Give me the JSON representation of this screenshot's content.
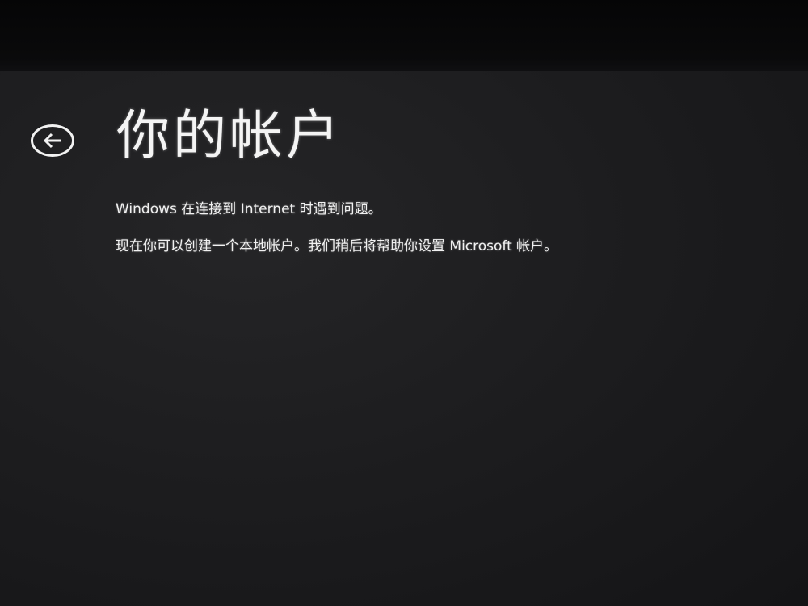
{
  "page": {
    "title": "你的帐户",
    "messages": [
      "Windows 在连接到 Internet 时遇到问题。",
      "现在你可以创建一个本地帐户。我们稍后将帮助你设置 Microsoft 帐户。"
    ]
  },
  "icons": {
    "back": "back-arrow-icon"
  },
  "colors": {
    "background": "#1d1d1f",
    "text": "#f1f1f1"
  }
}
